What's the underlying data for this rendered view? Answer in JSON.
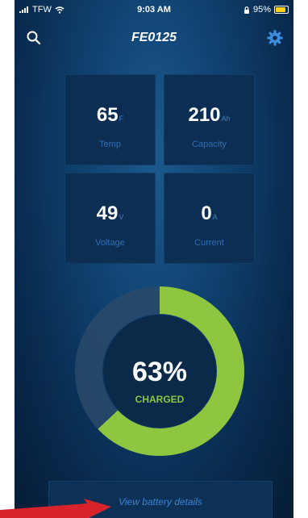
{
  "status_bar": {
    "carrier": "TFW",
    "time": "9:03 AM",
    "battery_pct": "95%"
  },
  "nav": {
    "title": "FE0125",
    "icons": {
      "left": "search-icon",
      "right": "gear-icon"
    }
  },
  "stats": [
    {
      "value": "65",
      "unit": "F",
      "label": "Temp"
    },
    {
      "value": "210",
      "unit": "Ah",
      "label": "Capacity"
    },
    {
      "value": "49",
      "unit": "V",
      "label": "Voltage"
    },
    {
      "value": "0",
      "unit": "A",
      "label": "Current"
    }
  ],
  "gauge": {
    "percent_text": "63%",
    "label": "CHARGED",
    "fraction": 0.63
  },
  "details": {
    "link_label": "View battery details"
  },
  "colors": {
    "accent_green": "#8fc63f",
    "accent_blue": "#3d82d1",
    "tile_bg": "#0b2e52",
    "arrow_red": "#d8232a"
  }
}
